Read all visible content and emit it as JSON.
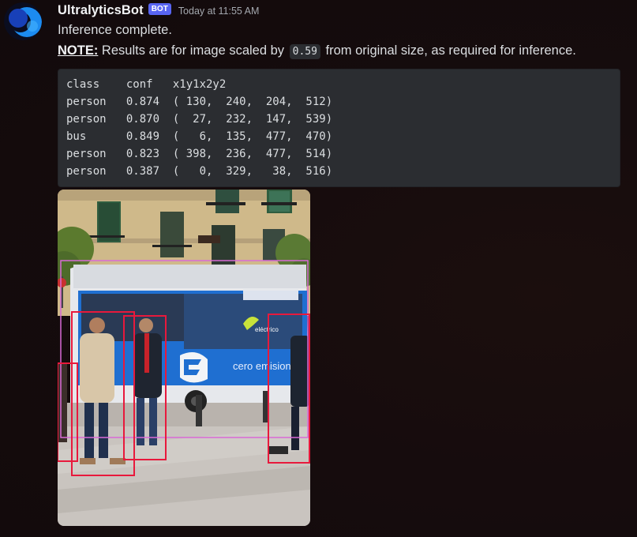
{
  "message": {
    "author": "UltralyticsBot",
    "bot_tag": "BOT",
    "timestamp": "Today at 11:55 AM",
    "line1": "Inference complete.",
    "note_label": "NOTE:",
    "note_pre": " Results are for image scaled by ",
    "scale": "0.59",
    "note_post": " from original size, as required for inference.",
    "code_lines": [
      "class    conf   x1y1x2y2",
      "person   0.874  ( 130,  240,  204,  512)",
      "person   0.870  (  27,  232,  147,  539)",
      "bus      0.849  (   6,  135,  477,  470)",
      "person   0.823  ( 398,  236,  477,  514)",
      "person   0.387  (   0,  329,   38,  516)"
    ],
    "bus_side_text": "cero emisiones",
    "bus_brand_text": "eléctrico"
  },
  "colors": {
    "bot_tag": "#5865f2",
    "code_bg": "#2b2d31",
    "person_box": "#e8193c",
    "bus_box": "#d96ad6"
  }
}
